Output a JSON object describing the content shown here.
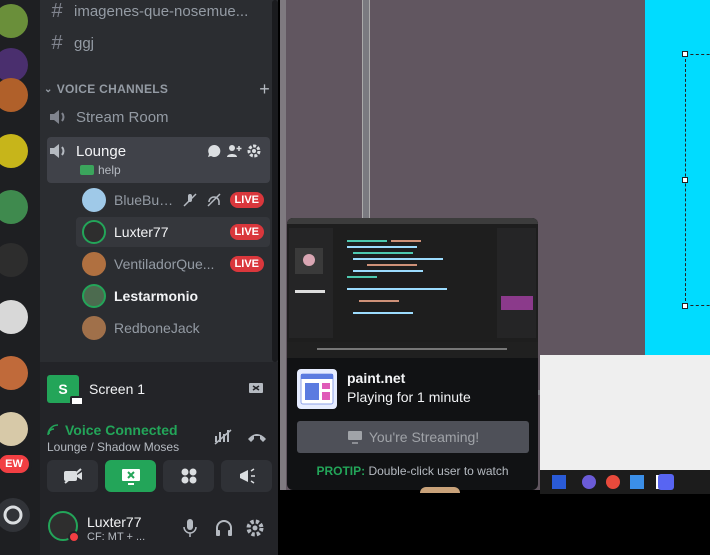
{
  "channels": {
    "text": [
      {
        "name": "imagenes-que-nosemue..."
      },
      {
        "name": "ggj"
      }
    ],
    "voice_category": "VOICE CHANNELS",
    "voice": [
      {
        "name": "Stream Room"
      },
      {
        "name": "Lounge",
        "status": "help"
      }
    ]
  },
  "voice_users": [
    {
      "name": "BlueBull...",
      "live": "LIVE"
    },
    {
      "name": "Luxter77",
      "live": "LIVE"
    },
    {
      "name": "VentiladorQue...",
      "live": "LIVE"
    },
    {
      "name": "Lestarmonio"
    },
    {
      "name": "RedboneJack"
    }
  ],
  "screen_share": {
    "icon_letter": "S",
    "label": "Screen 1"
  },
  "voice_status": {
    "title": "Voice Connected",
    "location": "Lounge / Shadow Moses"
  },
  "user_panel": {
    "name": "Luxter77",
    "status": "CF: MT + ..."
  },
  "server_badge": "EW",
  "stream_tooltip": {
    "app": "paint.net",
    "activity": "Playing for 1 minute",
    "button": "You're Streaming!",
    "protip_label": "PROTIP:",
    "protip_text": "Double-click user to watch"
  },
  "colors": {
    "green": "#23a559",
    "live_red": "#da373c",
    "sidebar_bg": "#2b2d31",
    "canvas_cyan": "#00dcff"
  }
}
